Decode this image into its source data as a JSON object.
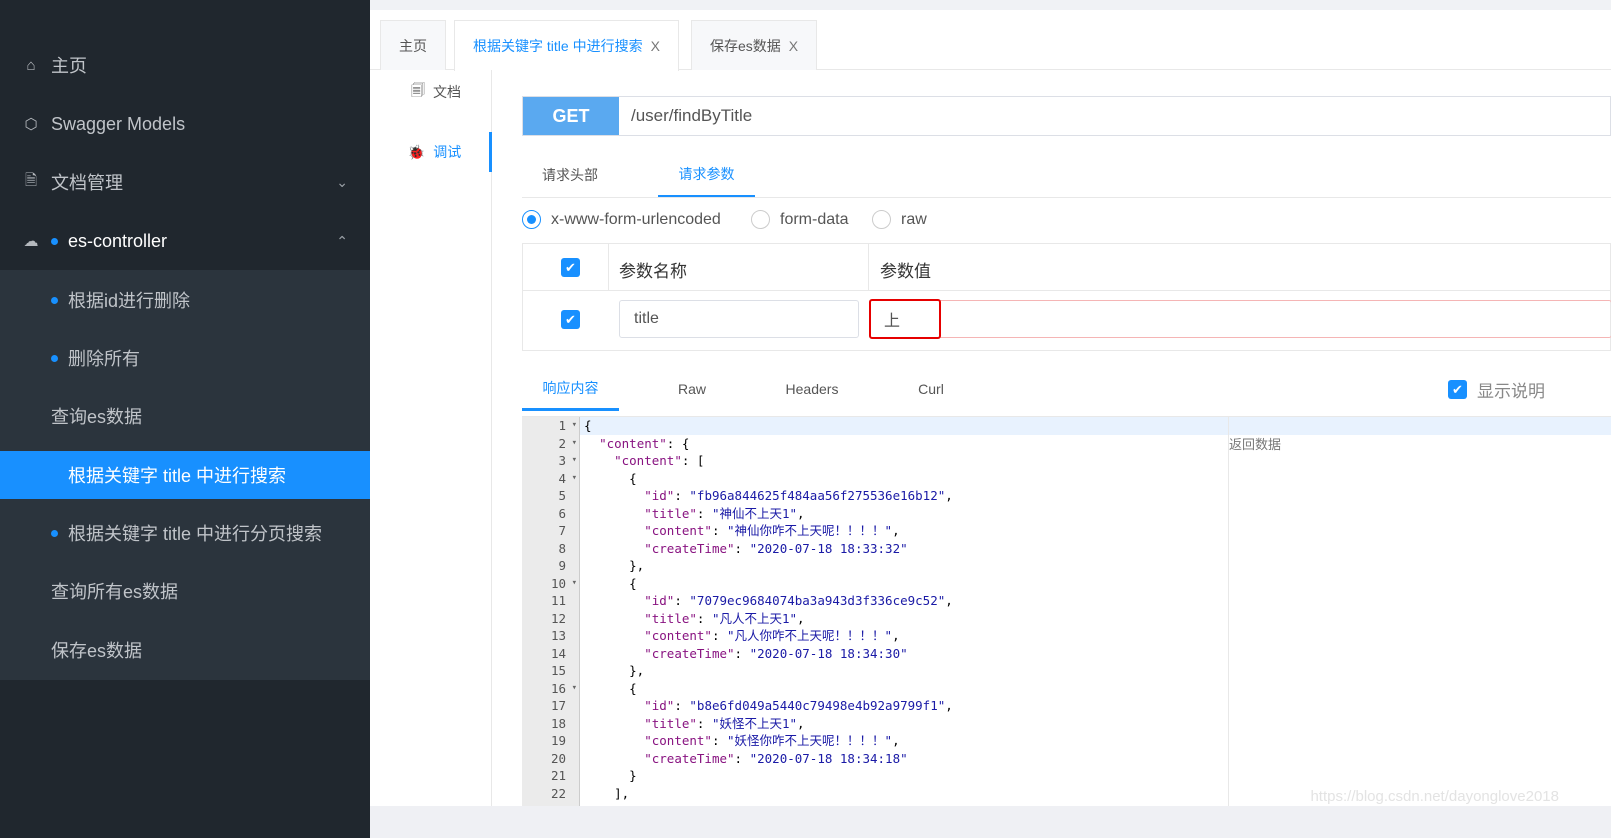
{
  "sidebar": {
    "items": [
      {
        "label": "主页",
        "icon": "home-icon"
      },
      {
        "label": "Swagger Models",
        "icon": "cube-icon"
      },
      {
        "label": "文档管理",
        "icon": "document-settings-icon"
      },
      {
        "label": "es-controller",
        "icon": "api-cloud-icon"
      }
    ],
    "sub_items": [
      {
        "label": "根据id进行删除"
      },
      {
        "label": "删除所有"
      },
      {
        "label": "查询es数据"
      },
      {
        "label": "根据关键字 title 中进行搜索"
      },
      {
        "label": "根据关键字 title 中进行分页搜索"
      },
      {
        "label": "查询所有es数据"
      },
      {
        "label": "保存es数据"
      }
    ]
  },
  "tabs": [
    {
      "label": "主页"
    },
    {
      "label": "根据关键字 title 中进行搜索",
      "close": "X"
    },
    {
      "label": "保存es数据",
      "close": "X"
    }
  ],
  "docnav": {
    "doc": "文档",
    "debug": "调试"
  },
  "request": {
    "method": "GET",
    "url": "/user/findByTitle",
    "tabs": [
      "请求头部",
      "请求参数"
    ],
    "content_types": [
      "x-www-form-urlencoded",
      "form-data",
      "raw"
    ],
    "table": {
      "headers": [
        "参数名称",
        "参数值"
      ],
      "rows": [
        {
          "name": "title",
          "value": "上"
        }
      ]
    }
  },
  "response": {
    "tabs": [
      "响应内容",
      "Raw",
      "Headers",
      "Curl"
    ],
    "show_desc": "显示说明",
    "desc_header": "返回数据",
    "lines": [
      [
        [
          "p",
          "{"
        ]
      ],
      [
        [
          "p",
          "  "
        ],
        [
          "k",
          "\"content\""
        ],
        [
          "p",
          ": {"
        ]
      ],
      [
        [
          "p",
          "    "
        ],
        [
          "k",
          "\"content\""
        ],
        [
          "p",
          ": ["
        ]
      ],
      [
        [
          "p",
          "      {"
        ]
      ],
      [
        [
          "p",
          "        "
        ],
        [
          "k",
          "\"id\""
        ],
        [
          "p",
          ": "
        ],
        [
          "s",
          "\"fb96a844625f484aa56f275536e16b12\""
        ],
        [
          "p",
          ","
        ]
      ],
      [
        [
          "p",
          "        "
        ],
        [
          "k",
          "\"title\""
        ],
        [
          "p",
          ": "
        ],
        [
          "s",
          "\"神仙不上天1\""
        ],
        [
          "p",
          ","
        ]
      ],
      [
        [
          "p",
          "        "
        ],
        [
          "k",
          "\"content\""
        ],
        [
          "p",
          ": "
        ],
        [
          "s",
          "\"神仙你咋不上天呢！！！！\""
        ],
        [
          "p",
          ","
        ]
      ],
      [
        [
          "p",
          "        "
        ],
        [
          "k",
          "\"createTime\""
        ],
        [
          "p",
          ": "
        ],
        [
          "s",
          "\"2020-07-18 18:33:32\""
        ]
      ],
      [
        [
          "p",
          "      },"
        ]
      ],
      [
        [
          "p",
          "      {"
        ]
      ],
      [
        [
          "p",
          "        "
        ],
        [
          "k",
          "\"id\""
        ],
        [
          "p",
          ": "
        ],
        [
          "s",
          "\"7079ec9684074ba3a943d3f336ce9c52\""
        ],
        [
          "p",
          ","
        ]
      ],
      [
        [
          "p",
          "        "
        ],
        [
          "k",
          "\"title\""
        ],
        [
          "p",
          ": "
        ],
        [
          "s",
          "\"凡人不上天1\""
        ],
        [
          "p",
          ","
        ]
      ],
      [
        [
          "p",
          "        "
        ],
        [
          "k",
          "\"content\""
        ],
        [
          "p",
          ": "
        ],
        [
          "s",
          "\"凡人你咋不上天呢！！！！\""
        ],
        [
          "p",
          ","
        ]
      ],
      [
        [
          "p",
          "        "
        ],
        [
          "k",
          "\"createTime\""
        ],
        [
          "p",
          ": "
        ],
        [
          "s",
          "\"2020-07-18 18:34:30\""
        ]
      ],
      [
        [
          "p",
          "      },"
        ]
      ],
      [
        [
          "p",
          "      {"
        ]
      ],
      [
        [
          "p",
          "        "
        ],
        [
          "k",
          "\"id\""
        ],
        [
          "p",
          ": "
        ],
        [
          "s",
          "\"b8e6fd049a5440c79498e4b92a9799f1\""
        ],
        [
          "p",
          ","
        ]
      ],
      [
        [
          "p",
          "        "
        ],
        [
          "k",
          "\"title\""
        ],
        [
          "p",
          ": "
        ],
        [
          "s",
          "\"妖怪不上天1\""
        ],
        [
          "p",
          ","
        ]
      ],
      [
        [
          "p",
          "        "
        ],
        [
          "k",
          "\"content\""
        ],
        [
          "p",
          ": "
        ],
        [
          "s",
          "\"妖怪你咋不上天呢！！！！\""
        ],
        [
          "p",
          ","
        ]
      ],
      [
        [
          "p",
          "        "
        ],
        [
          "k",
          "\"createTime\""
        ],
        [
          "p",
          ": "
        ],
        [
          "s",
          "\"2020-07-18 18:34:18\""
        ]
      ],
      [
        [
          "p",
          "      }"
        ]
      ],
      [
        [
          "p",
          "    ],"
        ]
      ]
    ],
    "fold_lines": [
      1,
      2,
      3,
      4,
      10,
      16
    ]
  },
  "watermark": "https://blog.csdn.net/dayonglove2018",
  "colors": {
    "accent": "#1890ff",
    "sidebar": "#20272e",
    "highlight_border": "#e60000"
  }
}
